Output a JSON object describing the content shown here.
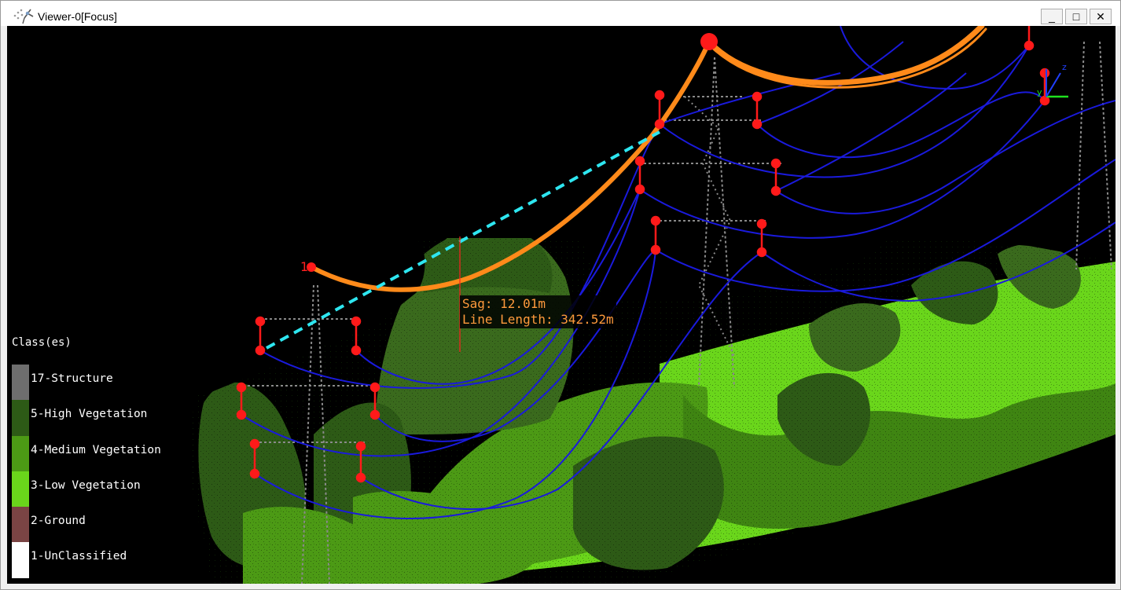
{
  "window": {
    "title": "Viewer-0[Focus]",
    "controls": {
      "minimize": "_",
      "maximize": "□",
      "close": "✕"
    }
  },
  "legend": {
    "title": "Class(es)",
    "items": [
      {
        "label": "17-Structure",
        "color": "#6e6e6e"
      },
      {
        "label": "5-High Vegetation",
        "color": "#2d5a16"
      },
      {
        "label": "4-Medium Vegetation",
        "color": "#4c9a15"
      },
      {
        "label": "3-Low Vegetation",
        "color": "#6ad61b"
      },
      {
        "label": "2-Ground",
        "color": "#7a4444"
      },
      {
        "label": "1-UnClassified",
        "color": "#ffffff"
      }
    ]
  },
  "measurement": {
    "sag": "Sag: 12.01m",
    "line_length": "Line Length: 342.52m",
    "point_label": "1"
  },
  "axes": {
    "y": "y",
    "z": "z"
  },
  "colors": {
    "wire": "#1a1adc",
    "selected_wire": "#ff8a1a",
    "insulator": "#ff1a1a",
    "chord": "#2ee6f0",
    "axis_x": "#1ee01e",
    "axis_z": "#2040ff"
  }
}
